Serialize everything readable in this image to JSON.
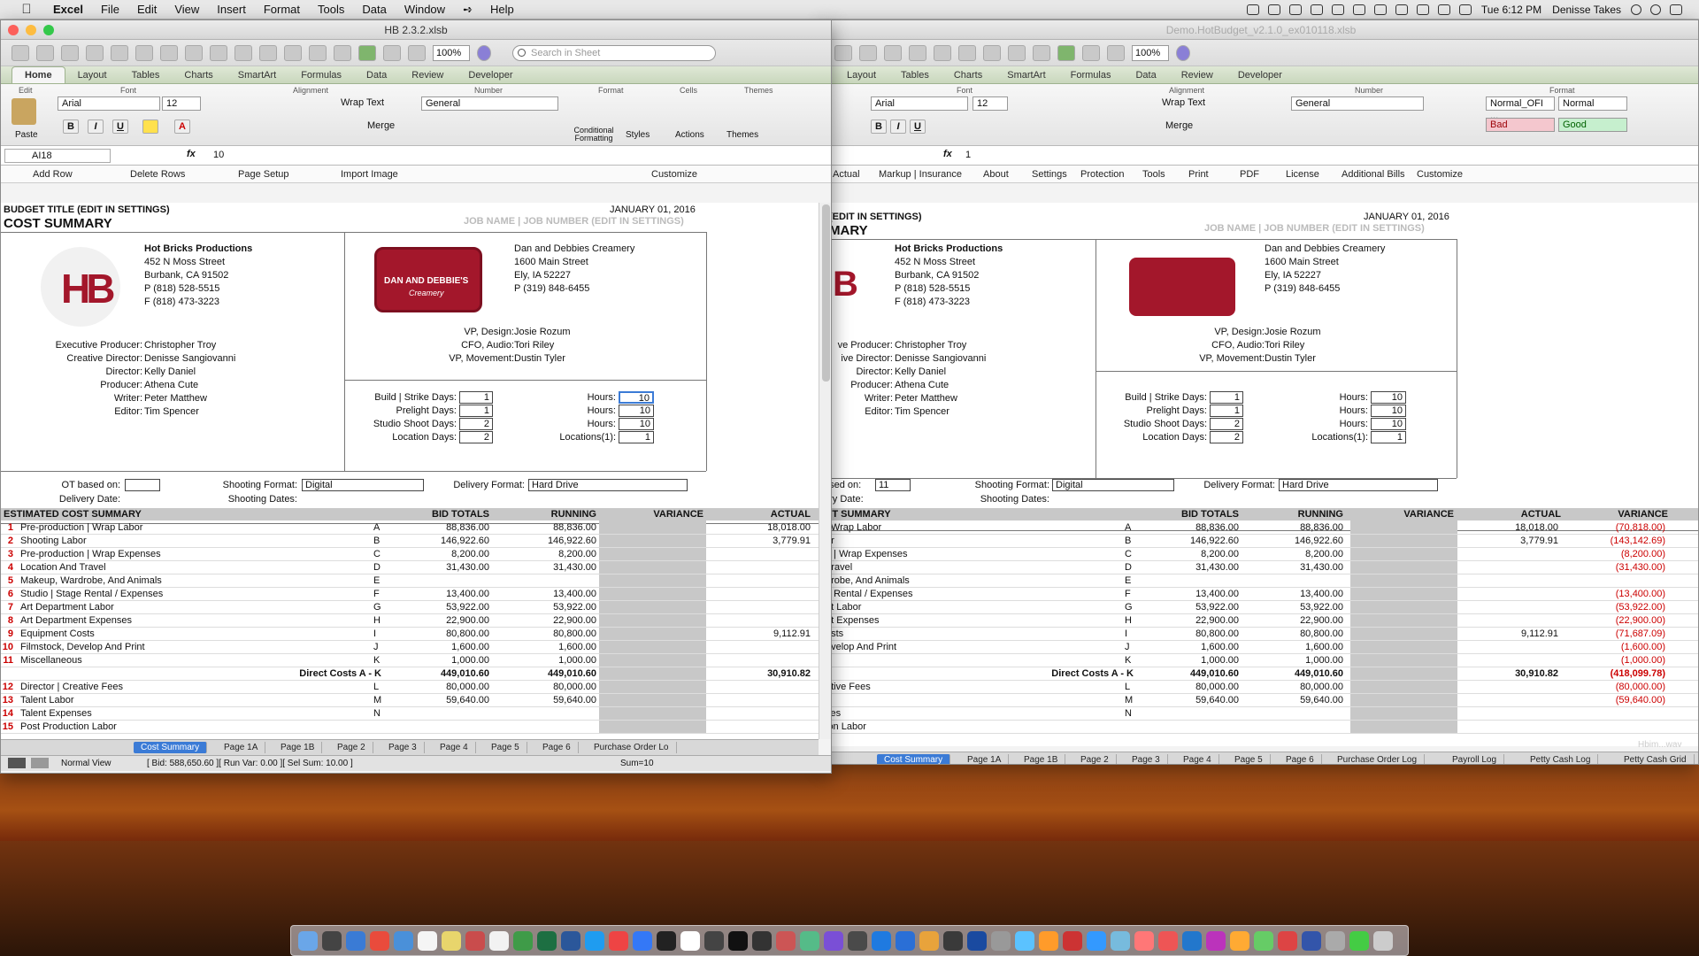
{
  "menubar": {
    "app": "Excel",
    "items": [
      "File",
      "Edit",
      "View",
      "Insert",
      "Format",
      "Tools",
      "Data",
      "Window",
      "Help"
    ],
    "clock": "Tue 6:12 PM",
    "user": "Denisse Takes"
  },
  "left_window": {
    "title": "HB 2.3.2.xlsb",
    "zoom": "100%",
    "search_placeholder": "Search in Sheet",
    "ribbon_tabs": [
      "Home",
      "Layout",
      "Tables",
      "Charts",
      "SmartArt",
      "Formulas",
      "Data",
      "Review",
      "Developer"
    ],
    "groups": [
      "Edit",
      "Font",
      "Alignment",
      "Number",
      "Format",
      "Cells",
      "Themes"
    ],
    "font": "Arial",
    "size": "12",
    "wrap": "Wrap Text",
    "number_format": "General",
    "merge": "Merge",
    "paste": "Paste",
    "cond_fmt": "Conditional Formatting",
    "styles": "Styles",
    "actions": "Actions",
    "themes": "Themes",
    "cell_ref": "AI18",
    "formula": "10",
    "commands": [
      "Add Row",
      "Delete Rows",
      "Page Setup",
      "Import Image",
      "Customize"
    ],
    "budget_title": "BUDGET TITLE (EDIT IN SETTINGS)",
    "heading": "COST SUMMARY",
    "date": "JANUARY 01, 2016",
    "job": "JOB NAME | JOB NUMBER (EDIT IN SETTINGS)",
    "logo_hb": "HB",
    "company": [
      "Hot Bricks Productions",
      "452 N Moss Street",
      "Burbank, CA 91502",
      "P (818) 528-5515",
      "F (818) 473-3223"
    ],
    "client_logo": [
      "DAN AND DEBBIE'S",
      "Creamery"
    ],
    "client": [
      "Dan and Debbies Creamery",
      "1600 Main Street",
      "Ely, IA 52227",
      "P (319) 848-6455"
    ],
    "client_roles": [
      [
        "VP, Design:",
        "Josie Rozum"
      ],
      [
        "CFO, Audio:",
        "Tori Riley"
      ],
      [
        "VP, Movement:",
        "Dustin Tyler"
      ]
    ],
    "crew": [
      [
        "Executive Producer:",
        "Christopher Troy"
      ],
      [
        "Creative Director:",
        "Denisse Sangiovanni"
      ],
      [
        "Director:",
        "Kelly Daniel"
      ],
      [
        "Producer:",
        "Athena Cute"
      ],
      [
        "Writer:",
        "Peter Matthew"
      ],
      [
        "Editor:",
        "Tim Spencer"
      ]
    ],
    "days": [
      [
        "Build | Strike Days:",
        "1",
        "Hours:",
        "10"
      ],
      [
        "Prelight Days:",
        "1",
        "Hours:",
        "10"
      ],
      [
        "Studio Shoot Days:",
        "2",
        "Hours:",
        "10"
      ],
      [
        "Location Days:",
        "2",
        "Locations(1):",
        "1"
      ]
    ],
    "ot_label": "OT based on:",
    "shoot_fmt_label": "Shooting Format:",
    "shoot_fmt": "Digital",
    "delivery_fmt_label": "Delivery Format:",
    "delivery_fmt": "Hard Drive",
    "delivery_date": "Delivery Date:",
    "shooting_dates": "Shooting Dates:",
    "table_headers": [
      "ESTIMATED COST SUMMARY",
      "BID TOTALS",
      "RUNNING",
      "VARIANCE",
      "ACTUAL"
    ],
    "rows": [
      [
        "1",
        "Pre-production | Wrap Labor",
        "A",
        "88,836.00",
        "88,836.00",
        "18,018.00"
      ],
      [
        "2",
        "Shooting Labor",
        "B",
        "146,922.60",
        "146,922.60",
        "3,779.91"
      ],
      [
        "3",
        "Pre-production | Wrap Expenses",
        "C",
        "8,200.00",
        "8,200.00",
        ""
      ],
      [
        "4",
        "Location And Travel",
        "D",
        "31,430.00",
        "31,430.00",
        ""
      ],
      [
        "5",
        "Makeup, Wardrobe, And Animals",
        "E",
        "",
        "",
        ""
      ],
      [
        "6",
        "Studio | Stage Rental / Expenses",
        "F",
        "13,400.00",
        "13,400.00",
        ""
      ],
      [
        "7",
        "Art Department Labor",
        "G",
        "53,922.00",
        "53,922.00",
        ""
      ],
      [
        "8",
        "Art Department Expenses",
        "H",
        "22,900.00",
        "22,900.00",
        ""
      ],
      [
        "9",
        "Equipment Costs",
        "I",
        "80,800.00",
        "80,800.00",
        "9,112.91"
      ],
      [
        "10",
        "Filmstock, Develop And Print",
        "J",
        "1,600.00",
        "1,600.00",
        ""
      ],
      [
        "11",
        "Miscellaneous",
        "K",
        "1,000.00",
        "1,000.00",
        ""
      ]
    ],
    "direct": [
      "Direct Costs A - K",
      "449,010.60",
      "449,010.60",
      "30,910.82"
    ],
    "rows2": [
      [
        "12",
        "Director | Creative Fees",
        "L",
        "80,000.00",
        "80,000.00"
      ],
      [
        "13",
        "Talent Labor",
        "M",
        "59,640.00",
        "59,640.00"
      ],
      [
        "14",
        "Talent Expenses",
        "N",
        "",
        ""
      ],
      [
        "15",
        "Post Production Labor",
        "",
        ""
      ]
    ],
    "sheet_tabs": [
      "Cost Summary",
      "Page 1A",
      "Page 1B",
      "Page 2",
      "Page 3",
      "Page 4",
      "Page 5",
      "Page 6",
      "Purchase Order Lo"
    ],
    "status_view": "Normal View",
    "status_info": "[ Bid: 588,650.60 ][ Run Var: 0.00 ][ Sel Sum: 10.00 ]",
    "status_sum": "Sum=10"
  },
  "right_window": {
    "title": "Demo.HotBudget_v2.1.0_ex010118.xlsb",
    "ribbon_tabs": [
      "Layout",
      "Tables",
      "Charts",
      "SmartArt",
      "Formulas",
      "Data",
      "Review",
      "Developer"
    ],
    "font": "Arial",
    "size": "12",
    "formula": "1",
    "wrap": "Wrap Text",
    "number_format": "General",
    "merge": "Merge",
    "styles": [
      "Normal_OFI ...",
      "Normal",
      "Bad",
      "Good"
    ],
    "groups": [
      "Font",
      "Alignment",
      "Number",
      "Format"
    ],
    "commands": [
      "Actual",
      "Markup | Insurance",
      "About",
      "Settings",
      "Protection",
      "Tools",
      "Print",
      "PDF",
      "License",
      "Additional Bills",
      "Customize"
    ],
    "budget_title": "(EDIT IN SETTINGS)",
    "heading": "MARY",
    "date": "JANUARY 01, 2016",
    "job": "JOB NAME | JOB NUMBER (EDIT IN SETTINGS)",
    "crew": [
      [
        "ve Producer:",
        "Christopher Troy"
      ],
      [
        "ive Director:",
        "Denisse Sangiovanni"
      ],
      [
        "Director:",
        "Kelly Daniel"
      ],
      [
        "Producer:",
        "Athena Cute"
      ],
      [
        "Writer:",
        "Peter Matthew"
      ],
      [
        "Editor:",
        "Tim Spencer"
      ]
    ],
    "ot_val": "11",
    "ot_label": "ased on:",
    "delivery_date": "ery Date:",
    "table_headers": [
      "ST SUMMARY",
      "BID TOTALS",
      "RUNNING",
      "VARIANCE",
      "ACTUAL",
      "VARIANCE"
    ],
    "rows": [
      [
        "| Wrap Labor",
        "A",
        "88,836.00",
        "88,836.00",
        "18,018.00",
        "(70,818.00)"
      ],
      [
        "or",
        "B",
        "146,922.60",
        "146,922.60",
        "3,779.91",
        "(143,142.69)"
      ],
      [
        "n | Wrap Expenses",
        "C",
        "8,200.00",
        "8,200.00",
        "",
        "(8,200.00)"
      ],
      [
        "Travel",
        "D",
        "31,430.00",
        "31,430.00",
        "",
        "(31,430.00)"
      ],
      [
        "drobe, And Animals",
        "E",
        "",
        "",
        "",
        ""
      ],
      [
        "e Rental / Expenses",
        "F",
        "13,400.00",
        "13,400.00",
        "",
        "(13,400.00)"
      ],
      [
        "nt Labor",
        "G",
        "53,922.00",
        "53,922.00",
        "",
        "(53,922.00)"
      ],
      [
        "nt Expenses",
        "H",
        "22,900.00",
        "22,900.00",
        "",
        "(22,900.00)"
      ],
      [
        "osts",
        "I",
        "80,800.00",
        "80,800.00",
        "9,112.91",
        "(71,687.09)"
      ],
      [
        "evelop And Print",
        "J",
        "1,600.00",
        "1,600.00",
        "",
        "(1,600.00)"
      ],
      [
        "s",
        "K",
        "1,000.00",
        "1,000.00",
        "",
        "(1,000.00)"
      ]
    ],
    "direct": [
      "Direct Costs A - K",
      "449,010.60",
      "449,010.60",
      "30,910.82",
      "(418,099.78)"
    ],
    "rows2": [
      [
        "ative Fees",
        "L",
        "80,000.00",
        "80,000.00",
        "(80,000.00)"
      ],
      [
        "",
        "M",
        "59,640.00",
        "59,640.00",
        "(59,640.00)"
      ],
      [
        "ses",
        "N",
        "",
        "",
        ""
      ],
      [
        "ion Labor",
        "",
        "",
        ""
      ]
    ],
    "sheet_tabs": [
      "Cost Summary",
      "Page 1A",
      "Page 1B",
      "Page 2",
      "Page 3",
      "Page 4",
      "Page 5",
      "Page 6",
      "Purchase Order Log",
      "Payroll Log",
      "Petty Cash Log",
      "Petty Cash Grid"
    ],
    "watermark": "Hbim...wav"
  },
  "colors": {
    "red": "#c00000",
    "tab_blue": "#3b7bd6",
    "logo_red": "#a3172b"
  }
}
